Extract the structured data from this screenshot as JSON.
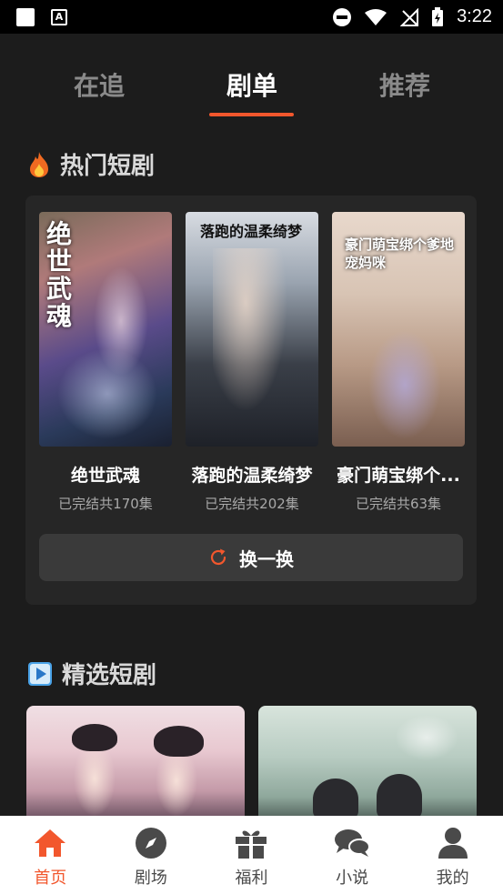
{
  "status_bar": {
    "time": "3:22",
    "a_icon_letter": "A"
  },
  "tabs": [
    {
      "label": "在追",
      "active": false
    },
    {
      "label": "剧单",
      "active": true
    },
    {
      "label": "推荐",
      "active": false
    }
  ],
  "hot_section": {
    "title": "热门短剧",
    "icon": "fire-icon",
    "dramas": [
      {
        "cover_title": "绝世武魂",
        "name": "绝世武魂",
        "meta": "已完结共170集"
      },
      {
        "cover_title": "落跑的温柔绮梦",
        "name": "落跑的温柔绮梦",
        "meta": "已完结共202集"
      },
      {
        "cover_title": "豪门萌宝绑个爹地宠妈咪",
        "name": "豪门萌宝绑个...",
        "meta": "已完结共63集"
      }
    ],
    "refresh_label": "换一换"
  },
  "featured_section": {
    "title": "精选短剧",
    "icon": "play-icon"
  },
  "bottom_nav": [
    {
      "label": "首页",
      "icon": "home-icon",
      "active": true
    },
    {
      "label": "剧场",
      "icon": "compass-icon",
      "active": false
    },
    {
      "label": "福利",
      "icon": "gift-icon",
      "active": false
    },
    {
      "label": "小说",
      "icon": "chat-icon",
      "active": false
    },
    {
      "label": "我的",
      "icon": "user-icon",
      "active": false
    }
  ],
  "colors": {
    "accent": "#f2572d",
    "background": "#1c1c1c",
    "card": "#262626"
  }
}
